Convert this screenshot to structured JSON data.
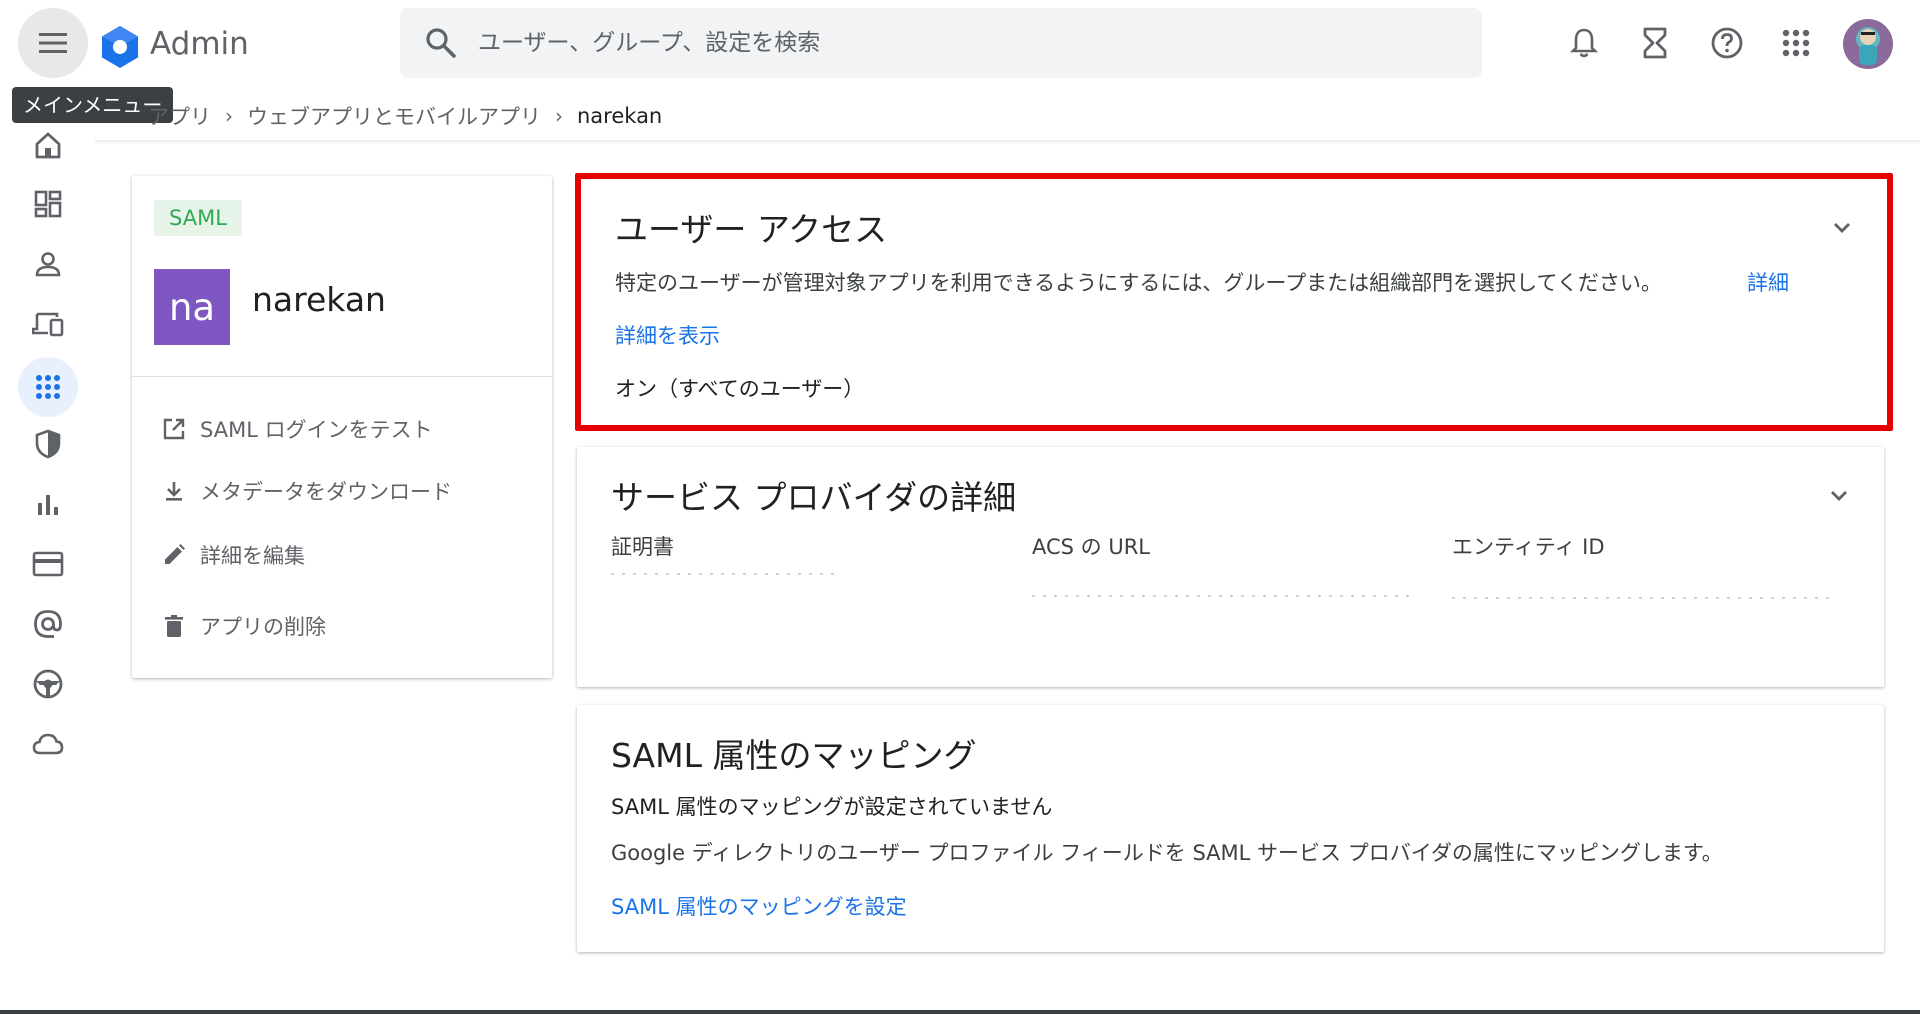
{
  "header": {
    "brand": "Admin",
    "search_placeholder": "ユーザー、グループ、設定を検索"
  },
  "tooltip": "メインメニュー",
  "breadcrumb": {
    "items": [
      "アプリ",
      "ウェブアプリとモバイルアプリ"
    ],
    "current": "narekan"
  },
  "rail": {
    "icons": [
      "home-icon",
      "dashboard-icon",
      "person-icon",
      "devices-icon",
      "apps-icon",
      "security-icon",
      "reports-icon",
      "billing-icon",
      "at-icon",
      "support-icon",
      "cloud-icon"
    ],
    "active": "apps-icon"
  },
  "app_card": {
    "badge": "SAML",
    "tile_initials": "na",
    "name": "narekan",
    "actions": [
      {
        "label": "SAML ログインをテスト",
        "icon": "open-in-new-icon"
      },
      {
        "label": "メタデータをダウンロード",
        "icon": "download-icon"
      },
      {
        "label": "詳細を編集",
        "icon": "edit-icon"
      },
      {
        "label": "アプリの削除",
        "icon": "delete-icon"
      }
    ]
  },
  "user_access": {
    "title": "ユーザー アクセス",
    "description": "特定のユーザーが管理対象アプリを利用できるようにするには、グループまたは組織部門を選択してください。",
    "desc_link": "詳細",
    "show_details": "詳細を表示",
    "status": "オン（すべてのユーザー）"
  },
  "service_provider": {
    "title": "サービス プロバイダの詳細",
    "columns": [
      "証明書",
      "ACS の URL",
      "エンティティ ID"
    ]
  },
  "attribute_mapping": {
    "title": "SAML 属性のマッピング",
    "status": "SAML 属性のマッピングが設定されていません",
    "description": "Google ディレクトリのユーザー プロファイル フィールドを SAML サービス プロバイダの属性にマッピングします。",
    "link": "SAML 属性のマッピングを設定"
  },
  "colors": {
    "accent": "#1a73e8",
    "highlight": "#e60000",
    "tile": "#7e57c2",
    "badge_text": "#34a853"
  }
}
